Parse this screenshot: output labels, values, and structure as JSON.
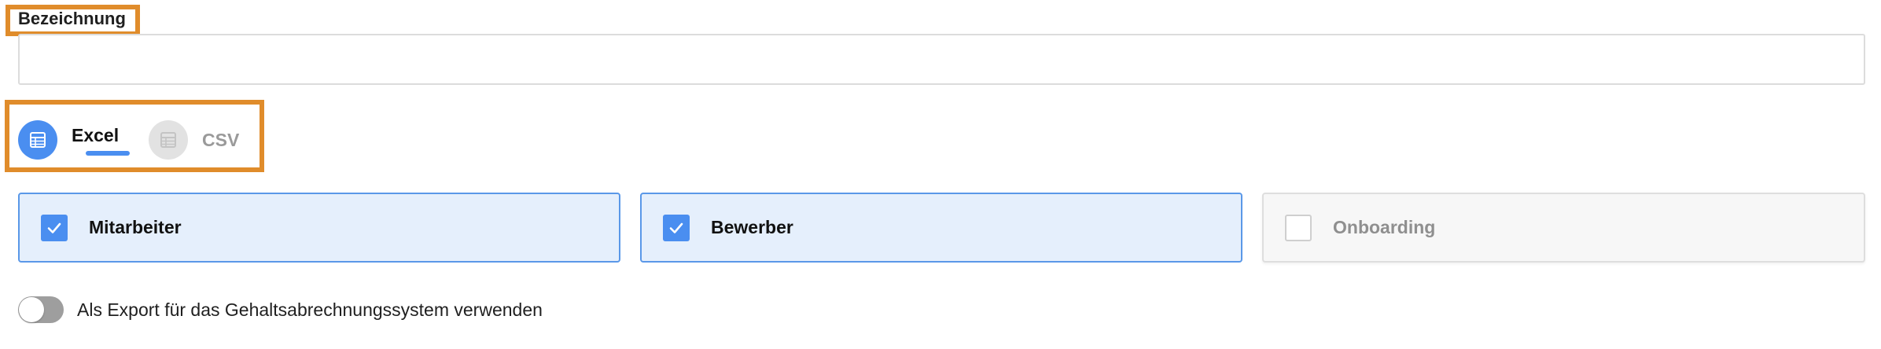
{
  "form": {
    "name_label": "Bezeichnung",
    "name_value": "",
    "name_placeholder": ""
  },
  "formats": {
    "selected": "Excel",
    "options": [
      {
        "label": "Excel",
        "active": true,
        "icon": "spreadsheet-icon"
      },
      {
        "label": "CSV",
        "active": false,
        "icon": "spreadsheet-icon"
      }
    ]
  },
  "categories": [
    {
      "label": "Mitarbeiter",
      "checked": true
    },
    {
      "label": "Bewerber",
      "checked": true
    },
    {
      "label": "Onboarding",
      "checked": false
    }
  ],
  "payroll_toggle": {
    "label": "Als Export für das Gehaltsabrechnungssystem verwenden",
    "enabled": false
  },
  "colors": {
    "accent": "#4a8ef0",
    "highlight": "#e08c2b",
    "checked_card_bg": "#e5effc",
    "checked_card_border": "#5a98e8",
    "inactive_icon_bg": "#e2e2e2",
    "toggle_off": "#9e9e9e"
  }
}
